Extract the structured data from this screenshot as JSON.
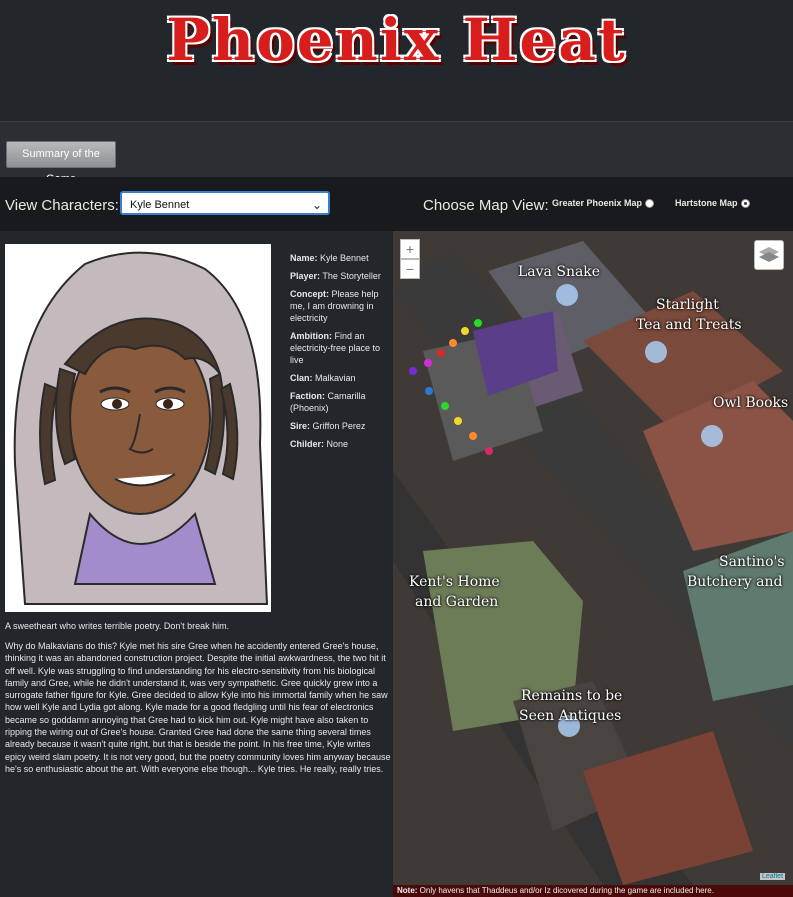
{
  "header": {
    "title": "Phoenix Heat"
  },
  "toolbar": {
    "summary_label": "Summary of the Game"
  },
  "controls": {
    "view_characters_label": "View Characters:",
    "selected_character": "Kyle Bennet",
    "choose_map_label": "Choose Map View:",
    "map_options": [
      {
        "label": "Greater Phoenix Map",
        "checked": false
      },
      {
        "label": "Hartstone Map",
        "checked": true
      }
    ]
  },
  "character": {
    "fields": [
      {
        "key": "Name:",
        "value": "Kyle Bennet"
      },
      {
        "key": "Player:",
        "value": "The Storyteller"
      },
      {
        "key": "Concept:",
        "value": "Please help me, I am drowning in electricity"
      },
      {
        "key": "Ambition:",
        "value": "Find an electricity-free place to live"
      },
      {
        "key": "Clan:",
        "value": "Malkavian"
      },
      {
        "key": "Faction:",
        "value": "Camarilla (Phoenix)"
      },
      {
        "key": "Sire:",
        "value": "Griffon Perez"
      },
      {
        "key": "Childer:",
        "value": "None"
      }
    ],
    "tagline": "A sweetheart who writes terrible poetry. Don't break him.",
    "bio": "Why do Malkavians do this? Kyle met his sire Gree when he accidently entered Gree's house, thinking it was an abandoned construction project. Despite the initial awkwardness, the two hit it off well. Kyle was struggling to find understanding for his electro-sensitivity from his biological family and Gree, while he didn't understand it, was very sympathetic. Gree quickly grew into a surrogate father figure for Kyle. Gree decided to allow Kyle into his immortal family when he saw how well Kyle and Lydia got along. Kyle made for a good fledgling until his fear of electronics became so goddamn annoying that Gree had to kick him out. Kyle might have also taken to ripping the wiring out of Gree's house. Granted Gree had done the same thing several times already because it wasn't quite right, but that is beside the point. In his free time, Kyle writes epicy weird slam poetry. It is not very good, but the poetry community loves him anyway because he's so enthusiastic about the art. With everyone else though... Kyle tries. He really, really tries."
  },
  "map": {
    "zoom_in": "+",
    "zoom_out": "−",
    "attribution": "Leaflet",
    "labels": {
      "lava_snake": "Lava Snake",
      "starlight_1": "Starlight",
      "starlight_2": "Tea and Treats",
      "owl_books": "Owl Books",
      "santinos_1": "Santino's",
      "santinos_2": "Butchery and",
      "kents_1": "Kent's Home",
      "kents_2": "and Garden",
      "remains_1": "Remains to be",
      "remains_2": "Seen Antiques"
    }
  },
  "note": {
    "label": "Note:",
    "text": " Only havens that Thaddeus and/or Iz dicovered during the game are included here."
  }
}
